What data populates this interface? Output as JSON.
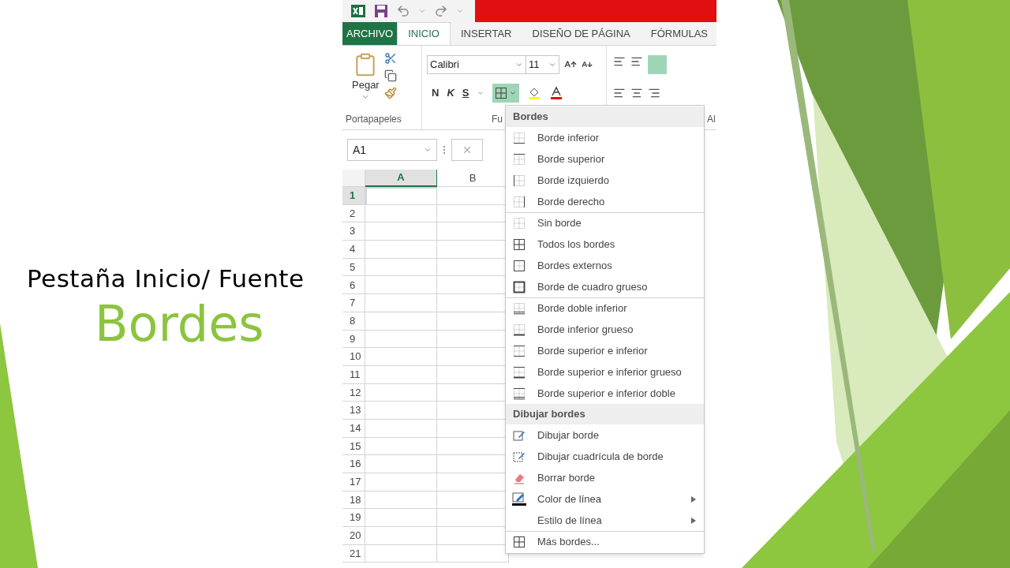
{
  "slide": {
    "subtitle": "Pestaña Inicio/ Fuente",
    "title": "Bordes"
  },
  "excel": {
    "tabs": [
      {
        "label": "ARCHIVO",
        "kind": "file",
        "selected": false
      },
      {
        "label": "INICIO",
        "kind": "tab",
        "selected": true
      },
      {
        "label": "INSERTAR",
        "kind": "tab",
        "selected": false
      },
      {
        "label": "DISEÑO DE PÁGINA",
        "kind": "tab",
        "selected": false
      },
      {
        "label": "FÓRMULAS",
        "kind": "tab",
        "selected": false
      }
    ],
    "ribbon": {
      "paste_label": "Pegar",
      "font": "Calibri",
      "size": "11",
      "format_buttons": [
        "N",
        "K",
        "S"
      ],
      "group_labels": [
        "Portapapeles",
        "Fu",
        "Al"
      ]
    },
    "name_box": "A1",
    "columns": [
      {
        "label": "A",
        "selected": true
      },
      {
        "label": "B",
        "selected": false
      }
    ],
    "rows": [
      {
        "label": "1",
        "selected": true
      },
      {
        "label": "2",
        "selected": false
      },
      {
        "label": "3",
        "selected": false
      },
      {
        "label": "4",
        "selected": false
      },
      {
        "label": "5",
        "selected": false
      },
      {
        "label": "6",
        "selected": false
      },
      {
        "label": "7",
        "selected": false
      },
      {
        "label": "8",
        "selected": false
      },
      {
        "label": "9",
        "selected": false
      },
      {
        "label": "10",
        "selected": false
      },
      {
        "label": "11",
        "selected": false
      },
      {
        "label": "12",
        "selected": false
      },
      {
        "label": "13",
        "selected": false
      },
      {
        "label": "14",
        "selected": false
      },
      {
        "label": "15",
        "selected": false
      },
      {
        "label": "16",
        "selected": false
      },
      {
        "label": "17",
        "selected": false
      },
      {
        "label": "18",
        "selected": false
      },
      {
        "label": "19",
        "selected": false
      },
      {
        "label": "20",
        "selected": false
      },
      {
        "label": "21",
        "selected": false
      }
    ],
    "menu": {
      "sections": [
        {
          "header": "Bordes",
          "items": [
            {
              "label": "Borde inferior",
              "kind": "bottom",
              "separator_before": false,
              "submenu": false
            },
            {
              "label": "Borde superior",
              "kind": "top",
              "separator_before": false,
              "submenu": false
            },
            {
              "label": "Borde izquierdo",
              "kind": "left",
              "separator_before": false,
              "submenu": false
            },
            {
              "label": "Borde derecho",
              "kind": "right",
              "separator_before": false,
              "submenu": false
            },
            {
              "label": "Sin borde",
              "kind": "none",
              "separator_before": true,
              "submenu": false
            },
            {
              "label": "Todos los bordes",
              "kind": "all",
              "separator_before": false,
              "submenu": false
            },
            {
              "label": "Bordes externos",
              "kind": "outside",
              "separator_before": false,
              "submenu": false
            },
            {
              "label": "Borde de cuadro grueso",
              "kind": "thick",
              "separator_before": false,
              "submenu": false
            },
            {
              "label": "Borde doble inferior",
              "kind": "double_bottom",
              "separator_before": true,
              "submenu": false
            },
            {
              "label": "Borde inferior grueso",
              "kind": "thick_bottom",
              "separator_before": false,
              "submenu": false
            },
            {
              "label": "Borde superior e inferior",
              "kind": "top_bottom",
              "separator_before": false,
              "submenu": false
            },
            {
              "label": "Borde superior e inferior grueso",
              "kind": "top_thick_bottom",
              "separator_before": false,
              "submenu": false
            },
            {
              "label": "Borde superior e inferior doble",
              "kind": "top_double_bottom",
              "separator_before": false,
              "submenu": false
            }
          ]
        },
        {
          "header": "Dibujar bordes",
          "items": [
            {
              "label": "Dibujar borde",
              "kind": "draw",
              "separator_before": false,
              "submenu": false
            },
            {
              "label": "Dibujar cuadrícula de borde",
              "kind": "draw_grid",
              "separator_before": false,
              "submenu": false
            },
            {
              "label": "Borrar borde",
              "kind": "eraser",
              "separator_before": false,
              "submenu": false
            },
            {
              "label": "Color de línea",
              "kind": "line_color",
              "separator_before": false,
              "submenu": true
            },
            {
              "label": "Estilo de línea",
              "kind": "blank",
              "separator_before": false,
              "submenu": true
            },
            {
              "label": "Más bordes...",
              "kind": "all",
              "separator_before": true,
              "submenu": false
            }
          ]
        }
      ]
    }
  }
}
